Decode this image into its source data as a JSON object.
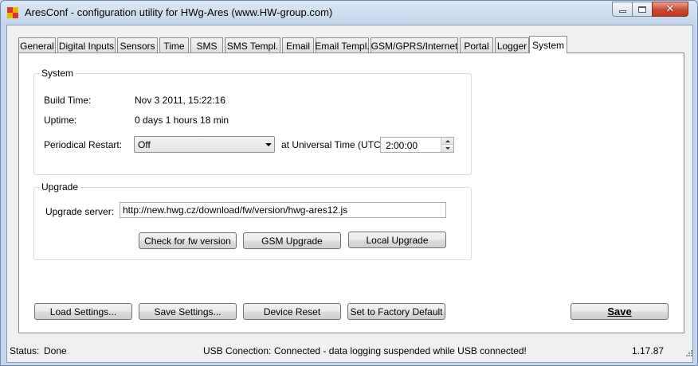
{
  "window": {
    "title": "AresConf - configuration utility for HWg-Ares (www.HW-group.com)",
    "icon": "app-icon",
    "controls": {
      "minimize": "minimize-icon",
      "maximize": "maximize-icon",
      "close": "✕"
    }
  },
  "tabs": [
    {
      "label": "General"
    },
    {
      "label": "Digital Inputs"
    },
    {
      "label": "Sensors"
    },
    {
      "label": "Time"
    },
    {
      "label": "SMS"
    },
    {
      "label": "SMS Templ."
    },
    {
      "label": "Email"
    },
    {
      "label": "Email Templ."
    },
    {
      "label": "GSM/GPRS/Internet"
    },
    {
      "label": "Portal"
    },
    {
      "label": "Logger"
    },
    {
      "label": "System",
      "active": true
    }
  ],
  "system": {
    "legend": "System",
    "build_time_label": "Build Time:",
    "build_time_value": "Nov  3 2011, 15:22:16",
    "uptime_label": "Uptime:",
    "uptime_value": "0 days 1 hours 18 min",
    "restart_label": "Periodical Restart:",
    "restart_value": "Off",
    "utc_label": "at Universal Time (UTC)",
    "utc_value": "2:00:00"
  },
  "upgrade": {
    "legend": "Upgrade",
    "server_label": "Upgrade server:",
    "server_value": "http://new.hwg.cz/download/fw/version/hwg-ares12.js",
    "check_button": "Check for fw version",
    "gsm_button": "GSM Upgrade",
    "local_button": "Local Upgrade"
  },
  "bottom": {
    "load": "Load Settings...",
    "save_settings": "Save Settings...",
    "reset": "Device Reset",
    "factory": "Set to Factory Default",
    "save": "Save"
  },
  "status": {
    "status_label": "Status:",
    "status_value": "Done",
    "usb_label": "USB Conection:",
    "usb_value": "Connected - data logging suspended while USB connected!",
    "version": "1.17.87"
  },
  "colors": {
    "window_frame": "#c4d6ec",
    "tab_border": "#898c95",
    "close_button": "#c84a2f",
    "group_border": "#d5dfe5"
  }
}
